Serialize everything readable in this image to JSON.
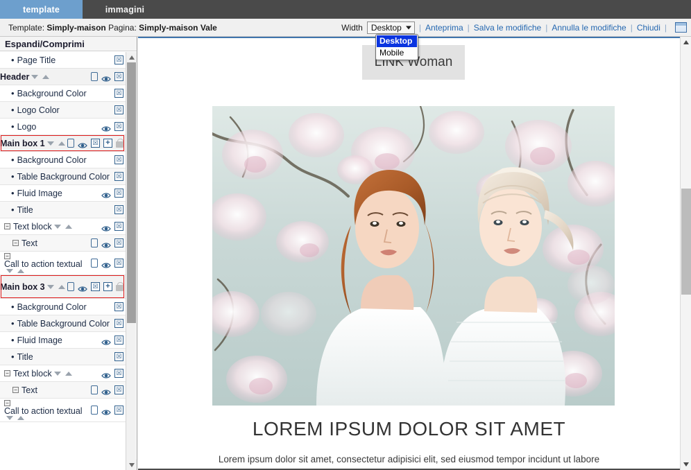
{
  "tabs": [
    {
      "label": "template",
      "active": true
    },
    {
      "label": "immagini",
      "active": false
    }
  ],
  "toolbar": {
    "template_prefix": "Template:",
    "template_name": "Simply-maison",
    "page_prefix": "Pagina:",
    "page_name": "Simply-maison Vale",
    "width_label": "Width",
    "width_value": "Desktop",
    "sep": "|",
    "links": [
      {
        "label": "Anteprima"
      },
      {
        "label": "Salva le modifiche"
      },
      {
        "label": "Annulla le modifiche"
      },
      {
        "label": "Chiudi"
      }
    ],
    "window_icon": "browser-window-icon"
  },
  "dropdown": {
    "open": true,
    "options": [
      {
        "label": "Desktop",
        "selected": true
      },
      {
        "label": "Mobile",
        "selected": false
      }
    ]
  },
  "sidebar": {
    "header": "Espandi/Comprimi",
    "rows": [
      {
        "label": "Page Title",
        "type": "leaf",
        "indent": 1,
        "bullet": true,
        "icons": [
          "target-icon"
        ]
      },
      {
        "label": "Header",
        "type": "group",
        "indent": 0,
        "bullet": false,
        "bold": true,
        "sort": [
          "triangle-down-icon",
          "triangle-up-icon"
        ],
        "icons": [
          "mobile-icon",
          "eye-icon",
          "target-icon"
        ]
      },
      {
        "label": "Background Color",
        "type": "leaf",
        "indent": 1,
        "bullet": true,
        "icons": [
          "target-icon"
        ]
      },
      {
        "label": "Logo Color",
        "type": "leaf",
        "indent": 1,
        "bullet": true,
        "icons": [
          "target-icon"
        ]
      },
      {
        "label": "Logo",
        "type": "leaf",
        "indent": 1,
        "bullet": true,
        "icons": [
          "eye-icon",
          "target-icon"
        ]
      },
      {
        "label": "Main box 1",
        "type": "group",
        "indent": 0,
        "bullet": false,
        "bold": true,
        "selected": true,
        "sort": [
          "triangle-down-icon",
          "triangle-up-icon"
        ],
        "icons": [
          "mobile-icon",
          "eye-icon",
          "target-icon",
          "plus-icon",
          "lock-icon"
        ]
      },
      {
        "label": "Background Color",
        "type": "leaf",
        "indent": 1,
        "bullet": true,
        "icons": [
          "target-icon"
        ]
      },
      {
        "label": "Table Background Color",
        "type": "leaf",
        "indent": 1,
        "bullet": true,
        "icons": [
          "target-icon"
        ]
      },
      {
        "label": "Fluid Image",
        "type": "leaf",
        "indent": 1,
        "bullet": true,
        "icons": [
          "eye-icon",
          "target-icon"
        ]
      },
      {
        "label": "Title",
        "type": "leaf",
        "indent": 1,
        "bullet": true,
        "icons": [
          "target-icon"
        ]
      },
      {
        "label": "Text block",
        "type": "node",
        "indent": 1,
        "bullet": false,
        "collapser": true,
        "sort": [
          "triangle-down-icon",
          "triangle-up-icon"
        ],
        "icons": [
          "eye-icon",
          "target-icon"
        ]
      },
      {
        "label": "Text",
        "type": "node",
        "indent": 2,
        "bullet": false,
        "collapser": true,
        "icons": [
          "mobile-icon",
          "eye-icon",
          "target-icon"
        ]
      },
      {
        "label": "Call to action textual",
        "type": "node",
        "indent": 1,
        "bullet": false,
        "collapser": true,
        "wrap": true,
        "sort": [
          "triangle-down-icon",
          "triangle-up-icon"
        ],
        "icons": [
          "mobile-icon",
          "eye-icon",
          "target-icon"
        ]
      },
      {
        "label": "Main box 3",
        "type": "group",
        "indent": 0,
        "bullet": false,
        "bold": true,
        "selected": true,
        "wrap": true,
        "sort": [
          "triangle-down-icon",
          "triangle-up-icon"
        ],
        "icons": [
          "mobile-icon",
          "eye-icon",
          "target-icon",
          "plus-icon",
          "lock-icon"
        ]
      },
      {
        "label": "Background Color",
        "type": "leaf",
        "indent": 1,
        "bullet": true,
        "icons": [
          "target-icon"
        ]
      },
      {
        "label": "Table Background Color",
        "type": "leaf",
        "indent": 1,
        "bullet": true,
        "icons": [
          "target-icon"
        ]
      },
      {
        "label": "Fluid Image",
        "type": "leaf",
        "indent": 1,
        "bullet": true,
        "icons": [
          "eye-icon",
          "target-icon"
        ]
      },
      {
        "label": "Title",
        "type": "leaf",
        "indent": 1,
        "bullet": true,
        "icons": [
          "target-icon"
        ]
      },
      {
        "label": "Text block",
        "type": "node",
        "indent": 1,
        "bullet": false,
        "collapser": true,
        "sort": [
          "triangle-down-icon",
          "triangle-up-icon"
        ],
        "icons": [
          "eye-icon",
          "target-icon"
        ]
      },
      {
        "label": "Text",
        "type": "node",
        "indent": 2,
        "bullet": false,
        "collapser": true,
        "icons": [
          "mobile-icon",
          "eye-icon",
          "target-icon"
        ]
      },
      {
        "label": "Call to action textual",
        "type": "node",
        "indent": 1,
        "bullet": false,
        "collapser": true,
        "wrap": true,
        "sort": [
          "triangle-down-icon",
          "triangle-up-icon"
        ],
        "icons": [
          "mobile-icon",
          "eye-icon",
          "target-icon"
        ]
      }
    ]
  },
  "preview": {
    "link_label": "LINK Woman",
    "hero_image_alt": "two-women-magnolia-blossoms-photo",
    "heading": "LOREM IPSUM DOLOR SIT AMET",
    "paragraph": "Lorem ipsum dolor sit amet, consectetur adipisici elit, sed eiusmod tempor incidunt ut labore"
  },
  "colors": {
    "tab_active": "#6d9fcd",
    "tabbar": "#4a4a4a",
    "link": "#2467b0",
    "selection_outline": "#e01b1b",
    "dropdown_selected": "#0a34e0",
    "preview_top_border": "#3f74ac"
  }
}
